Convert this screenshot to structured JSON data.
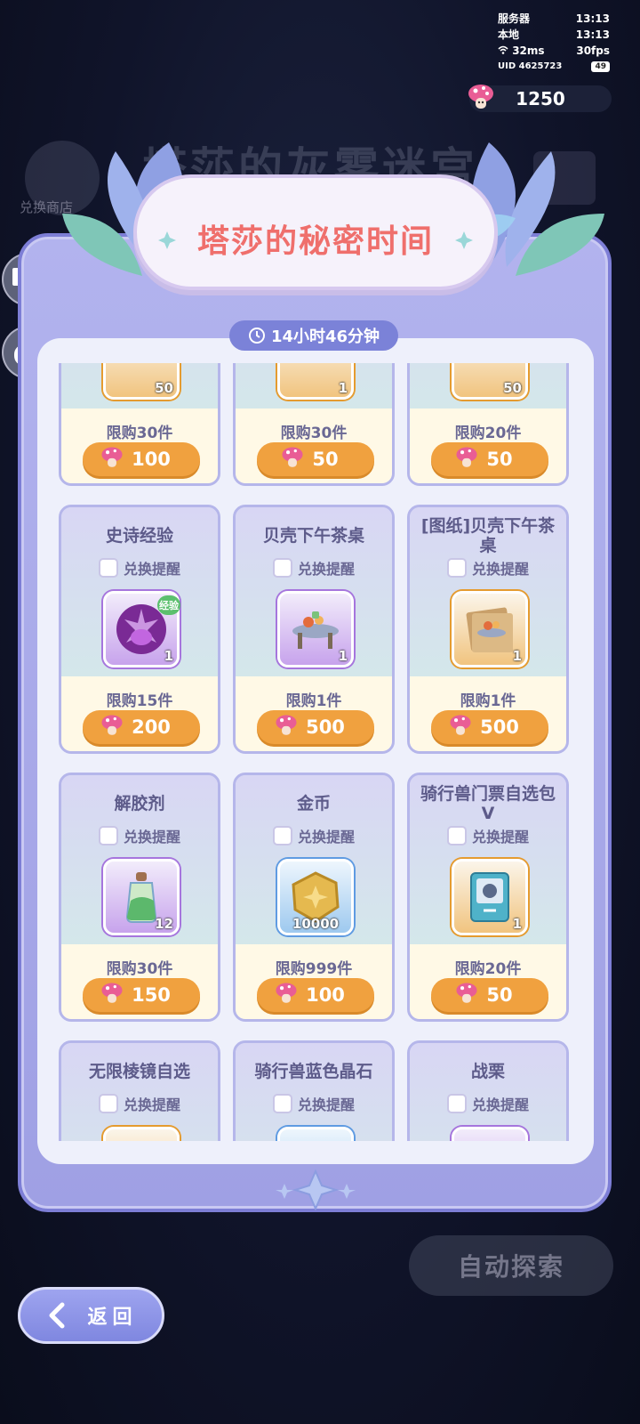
{
  "status": {
    "server_label": "服务器",
    "server_time": "13:13",
    "local_label": "本地",
    "local_time": "13:13",
    "ping": "32ms",
    "fps": "30fps",
    "uid": "UID 4625723",
    "battery": "49"
  },
  "currency": {
    "amount": "1250",
    "icon": "mushroom-icon"
  },
  "background": {
    "title": "塔莎的灰雾迷宫",
    "shop_label": "兑换商店",
    "auto_explore": "自动探索"
  },
  "modal": {
    "title": "塔莎的秘密时间",
    "timer": "14小时46分钟"
  },
  "shop_items": [
    {
      "name": "",
      "remind": "",
      "qty": "50",
      "frame": "orange",
      "limit": "限购30件",
      "price": "100"
    },
    {
      "name": "",
      "remind": "",
      "qty": "1",
      "frame": "orange",
      "limit": "限购30件",
      "price": "50"
    },
    {
      "name": "",
      "remind": "",
      "qty": "50",
      "frame": "orange",
      "limit": "限购20件",
      "price": "50"
    },
    {
      "name": "史诗经验",
      "remind": "兑换提醒",
      "qty": "1",
      "frame": "purple",
      "badge": "经验",
      "limit": "限购15件",
      "price": "200"
    },
    {
      "name": "贝壳下午茶桌",
      "remind": "兑换提醒",
      "qty": "1",
      "frame": "purple",
      "limit": "限购1件",
      "price": "500"
    },
    {
      "name": "[图纸]贝壳下午茶桌",
      "remind": "兑换提醒",
      "qty": "1",
      "frame": "orange",
      "limit": "限购1件",
      "price": "500"
    },
    {
      "name": "解胶剂",
      "remind": "兑换提醒",
      "qty": "12",
      "frame": "purple",
      "limit": "限购30件",
      "price": "150"
    },
    {
      "name": "金币",
      "remind": "兑换提醒",
      "qty": "10000",
      "frame": "blue",
      "limit": "限购999件",
      "price": "100"
    },
    {
      "name": "骑行兽门票自选包V",
      "remind": "兑换提醒",
      "qty": "1",
      "frame": "orange",
      "limit": "限购20件",
      "price": "50"
    },
    {
      "name": "无限棱镜自选",
      "remind": "兑换提醒",
      "qty": "",
      "frame": "orange",
      "limit": "",
      "price": ""
    },
    {
      "name": "骑行兽蓝色晶石",
      "remind": "兑换提醒",
      "qty": "",
      "frame": "blue",
      "limit": "",
      "price": ""
    },
    {
      "name": "战栗",
      "remind": "兑换提醒",
      "qty": "",
      "frame": "purple",
      "limit": "",
      "price": ""
    }
  ],
  "back_button": {
    "label": "返回"
  },
  "colors": {
    "accent": "#7b82d8",
    "price_orange": "#f0a13f",
    "title_red": "#ef6f6c"
  }
}
